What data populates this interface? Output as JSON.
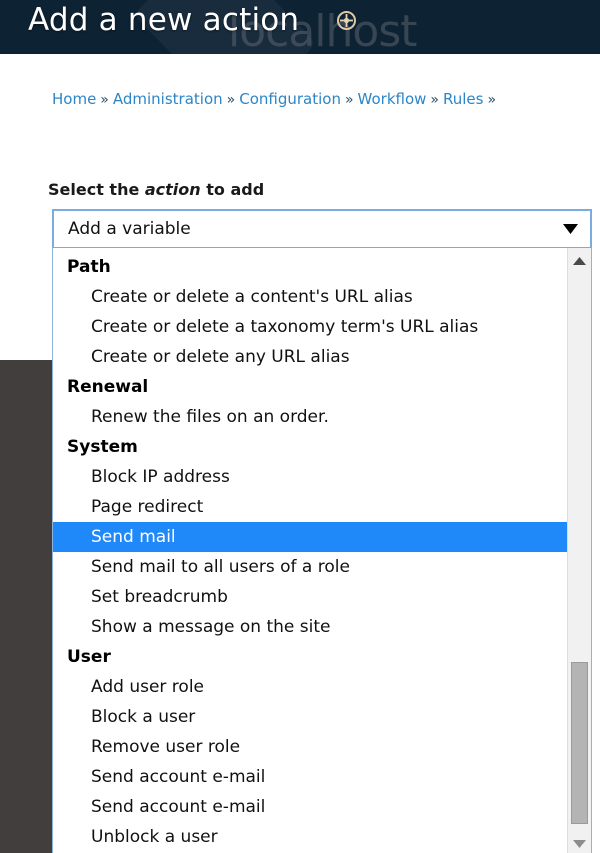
{
  "header": {
    "title": "Add a new action",
    "watermark": "localhost",
    "icon": "move-crosshair-icon",
    "background_color": "#0d2233"
  },
  "breadcrumb": {
    "separator": "»",
    "items": [
      {
        "label": "Home"
      },
      {
        "label": "Administration"
      },
      {
        "label": "Configuration"
      },
      {
        "label": "Workflow"
      },
      {
        "label": "Rules"
      }
    ],
    "trailing_separator": "»",
    "link_color": "#2b86c8"
  },
  "form": {
    "label_prefix": "Select the ",
    "label_emphasis": "action",
    "label_suffix": " to add",
    "select": {
      "value": "Add a variable",
      "arrow_icon": "chevron-down-icon",
      "focus_border_color": "#7aacde"
    }
  },
  "dropdown": {
    "selected_option": "Send mail",
    "highlight_color": "#2089fa",
    "scrollbar": {
      "up_arrow_icon": "scroll-up-arrow-icon",
      "down_arrow_icon": "scroll-down-arrow-icon",
      "thumb_label": "scrollbar-thumb"
    },
    "rows": [
      {
        "type": "group",
        "label": "Path"
      },
      {
        "type": "option",
        "label": "Create or delete a content's URL alias"
      },
      {
        "type": "option",
        "label": "Create or delete a taxonomy term's URL alias"
      },
      {
        "type": "option",
        "label": "Create or delete any URL alias"
      },
      {
        "type": "group",
        "label": "Renewal"
      },
      {
        "type": "option",
        "label": "Renew the files on an order."
      },
      {
        "type": "group",
        "label": "System"
      },
      {
        "type": "option",
        "label": "Block IP address"
      },
      {
        "type": "option",
        "label": "Page redirect"
      },
      {
        "type": "option",
        "label": "Send mail",
        "selected": true
      },
      {
        "type": "option",
        "label": "Send mail to all users of a role"
      },
      {
        "type": "option",
        "label": "Set breadcrumb"
      },
      {
        "type": "option",
        "label": "Show a message on the site"
      },
      {
        "type": "group",
        "label": "User"
      },
      {
        "type": "option",
        "label": "Add user role"
      },
      {
        "type": "option",
        "label": "Block a user"
      },
      {
        "type": "option",
        "label": "Remove user role"
      },
      {
        "type": "option",
        "label": "Send account e-mail"
      },
      {
        "type": "option",
        "label": "Send account e-mail"
      },
      {
        "type": "option",
        "label": "Unblock a user"
      }
    ]
  },
  "sidebar": {
    "block_color": "#413e3d"
  }
}
